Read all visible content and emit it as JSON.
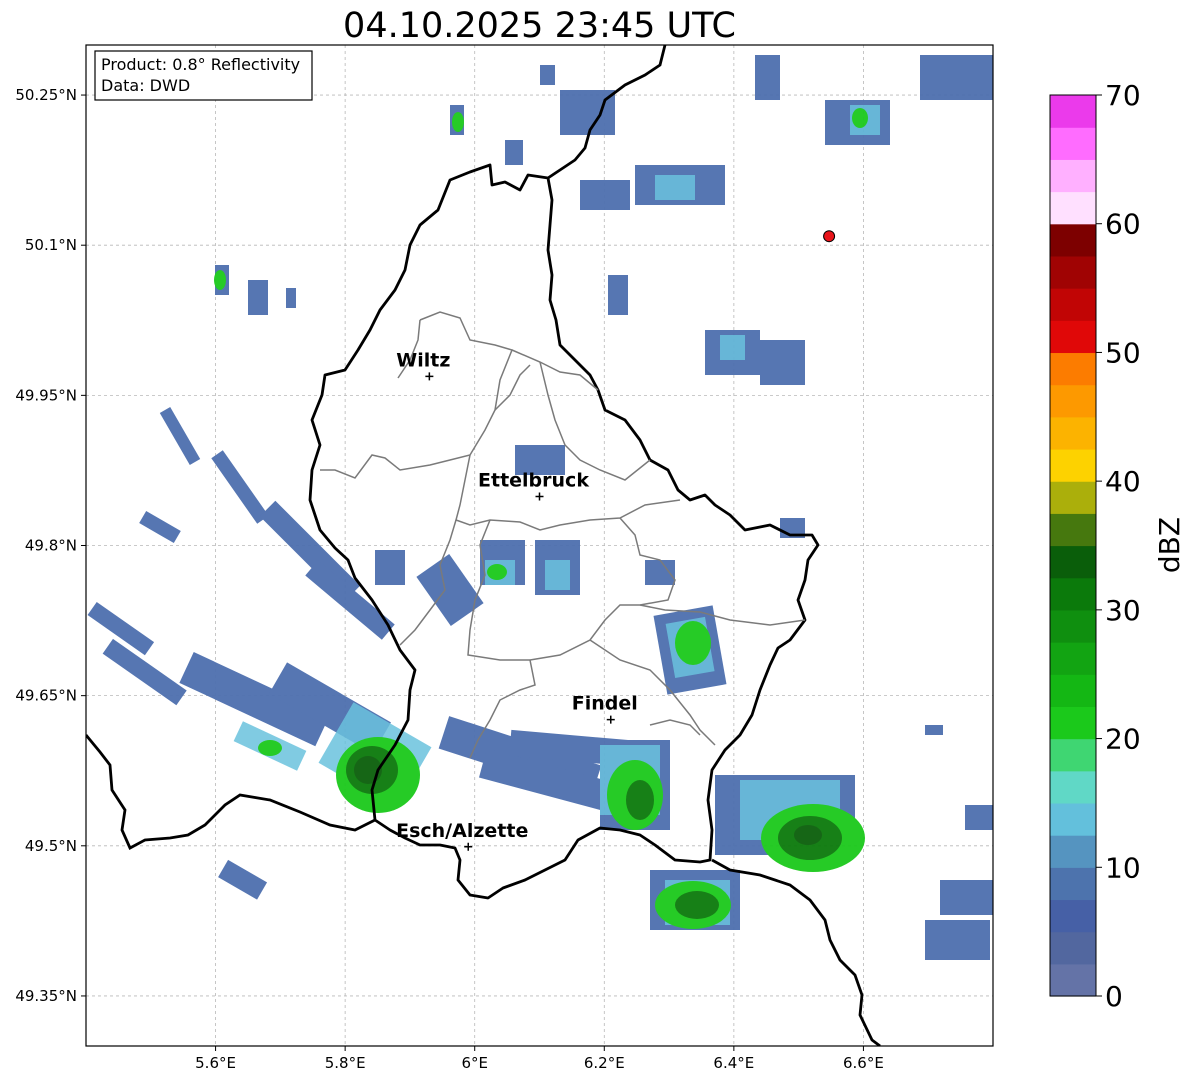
{
  "title": "04.10.2025 23:45 UTC",
  "info_box": {
    "line1": "Product: 0.8° Reflectivity",
    "line2": "Data: DWD"
  },
  "axes": {
    "lon_ticks": [
      "5.6°E",
      "5.8°E",
      "6°E",
      "6.2°E",
      "6.4°E",
      "6.6°E"
    ],
    "lat_ticks": [
      "50.25°N",
      "50.1°N",
      "49.95°N",
      "49.8°N",
      "49.65°N",
      "49.5°N",
      "49.35°N"
    ],
    "lon_values": [
      5.6,
      5.8,
      6.0,
      6.2,
      6.4,
      6.6
    ],
    "lat_values": [
      50.25,
      50.1,
      49.95,
      49.8,
      49.65,
      49.5,
      49.35
    ],
    "xlim": [
      5.4,
      6.8
    ],
    "ylim": [
      49.3,
      50.3
    ],
    "grid": true
  },
  "cities": [
    {
      "name": "Wiltz",
      "lon": 5.93,
      "lat": 49.969
    },
    {
      "name": "Ettelbruck",
      "lon": 6.1,
      "lat": 49.849
    },
    {
      "name": "Findel",
      "lon": 6.21,
      "lat": 49.626
    },
    {
      "name": "Esch/Alzette",
      "lon": 5.99,
      "lat": 49.499
    }
  ],
  "radar_site": {
    "lon": 6.547,
    "lat": 50.109,
    "color": "#e8141a"
  },
  "colorbar": {
    "label": "dBZ",
    "ticks": [
      "0",
      "10",
      "20",
      "30",
      "40",
      "50",
      "60",
      "70"
    ],
    "colors": [
      "#6473a7",
      "#52679f",
      "#4660a6",
      "#4d73ad",
      "#5594c0",
      "#63c0dc",
      "#60d8c6",
      "#3fd672",
      "#1bc91b",
      "#14b714",
      "#12a412",
      "#0f8f0f",
      "#0b7a0b",
      "#0a5e0a",
      "#46780e",
      "#abaf0b",
      "#fdd200",
      "#fcb300",
      "#fd9900",
      "#fc7c00",
      "#e00808",
      "#c10505",
      "#a00303",
      "#7d0000",
      "#ffe0ff",
      "#ffb0ff",
      "#ff6cff",
      "#eb3aeb"
    ]
  },
  "echoes": [
    {
      "lon": 5.88,
      "lat": 49.565,
      "rx": 0.06,
      "ry": 0.045,
      "core": "#0a5e0a"
    },
    {
      "lon": 6.53,
      "lat": 49.5,
      "rx": 0.09,
      "ry": 0.05,
      "core": "#0b7a0b"
    },
    {
      "lon": 6.35,
      "lat": 49.43,
      "rx": 0.07,
      "ry": 0.04,
      "core": "#12a412"
    },
    {
      "lon": 6.24,
      "lat": 49.55,
      "rx": 0.05,
      "ry": 0.05,
      "core": "#14b714"
    },
    {
      "lon": 6.34,
      "lat": 49.7,
      "rx": 0.04,
      "ry": 0.05,
      "core": "#1bc91b"
    },
    {
      "lon": 5.7,
      "lat": 49.62,
      "rx": 0.1,
      "ry": 0.04,
      "core": "#4660a6"
    },
    {
      "lon": 6.1,
      "lat": 49.55,
      "rx": 0.14,
      "ry": 0.04,
      "core": "#4d73ad"
    }
  ]
}
